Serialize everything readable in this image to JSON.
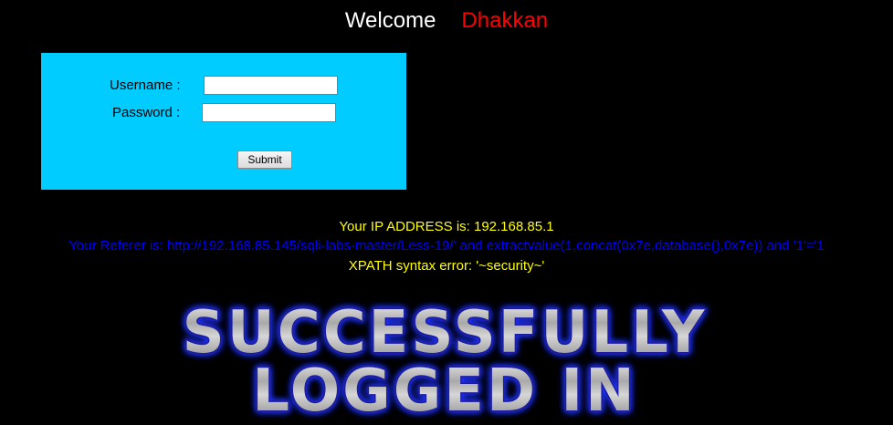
{
  "header": {
    "welcome": "Welcome",
    "name": "Dhakkan"
  },
  "login_form": {
    "username_label": "Username :",
    "password_label": "Password :",
    "username_value": "",
    "password_value": "",
    "submit_label": "Submit"
  },
  "messages": {
    "ip_address": "Your IP ADDRESS is: 192.168.85.1",
    "referer": "Your Referer is: http://192.168.85.145/sqli-labs-master/Less-19/' and extractvalue(1,concat(0x7e,database(),0x7e)) and '1'='1",
    "xpath_error": "XPATH syntax error: '~security~'"
  },
  "banner": {
    "line1": "SUCCESSFULLY",
    "line2": "LOGGED IN"
  },
  "colors": {
    "background": "#000000",
    "form_background": "#00ccff",
    "welcome_text": "#ffffff",
    "name_text": "#ff0000",
    "ip_text": "#ffff00",
    "referer_text": "#0000ff",
    "error_text": "#ffff00",
    "banner_glow": "#2222ff",
    "banner_metal": "#b8b8b8"
  }
}
